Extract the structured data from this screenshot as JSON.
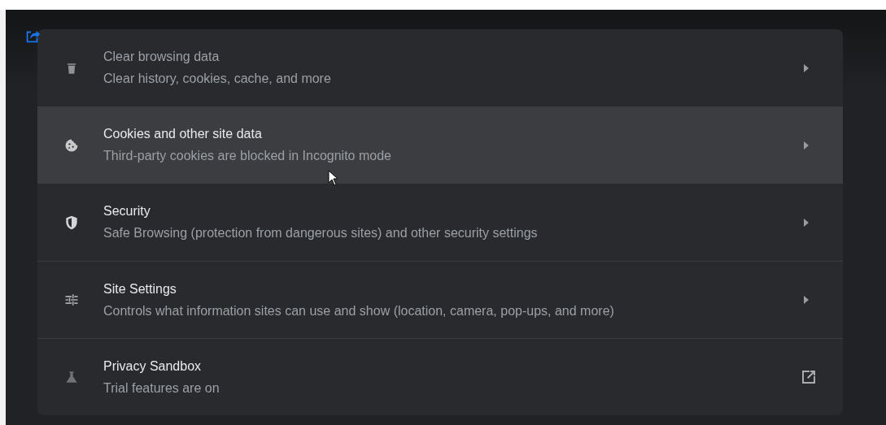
{
  "rows": [
    {
      "title": "Clear browsing data",
      "subtitle": "Clear history, cookies, cache, and more",
      "kind": "arrow",
      "highlighted": false
    },
    {
      "title": "Cookies and other site data",
      "subtitle": "Third-party cookies are blocked in Incognito mode",
      "kind": "arrow",
      "highlighted": true
    },
    {
      "title": "Security",
      "subtitle": "Safe Browsing (protection from dangerous sites) and other security settings",
      "kind": "arrow",
      "highlighted": false
    },
    {
      "title": "Site Settings",
      "subtitle": "Controls what information sites can use and show (location, camera, pop-ups, and more)",
      "kind": "arrow",
      "highlighted": false
    },
    {
      "title": "Privacy Sandbox",
      "subtitle": "Trial features are on",
      "kind": "external",
      "highlighted": false
    }
  ]
}
